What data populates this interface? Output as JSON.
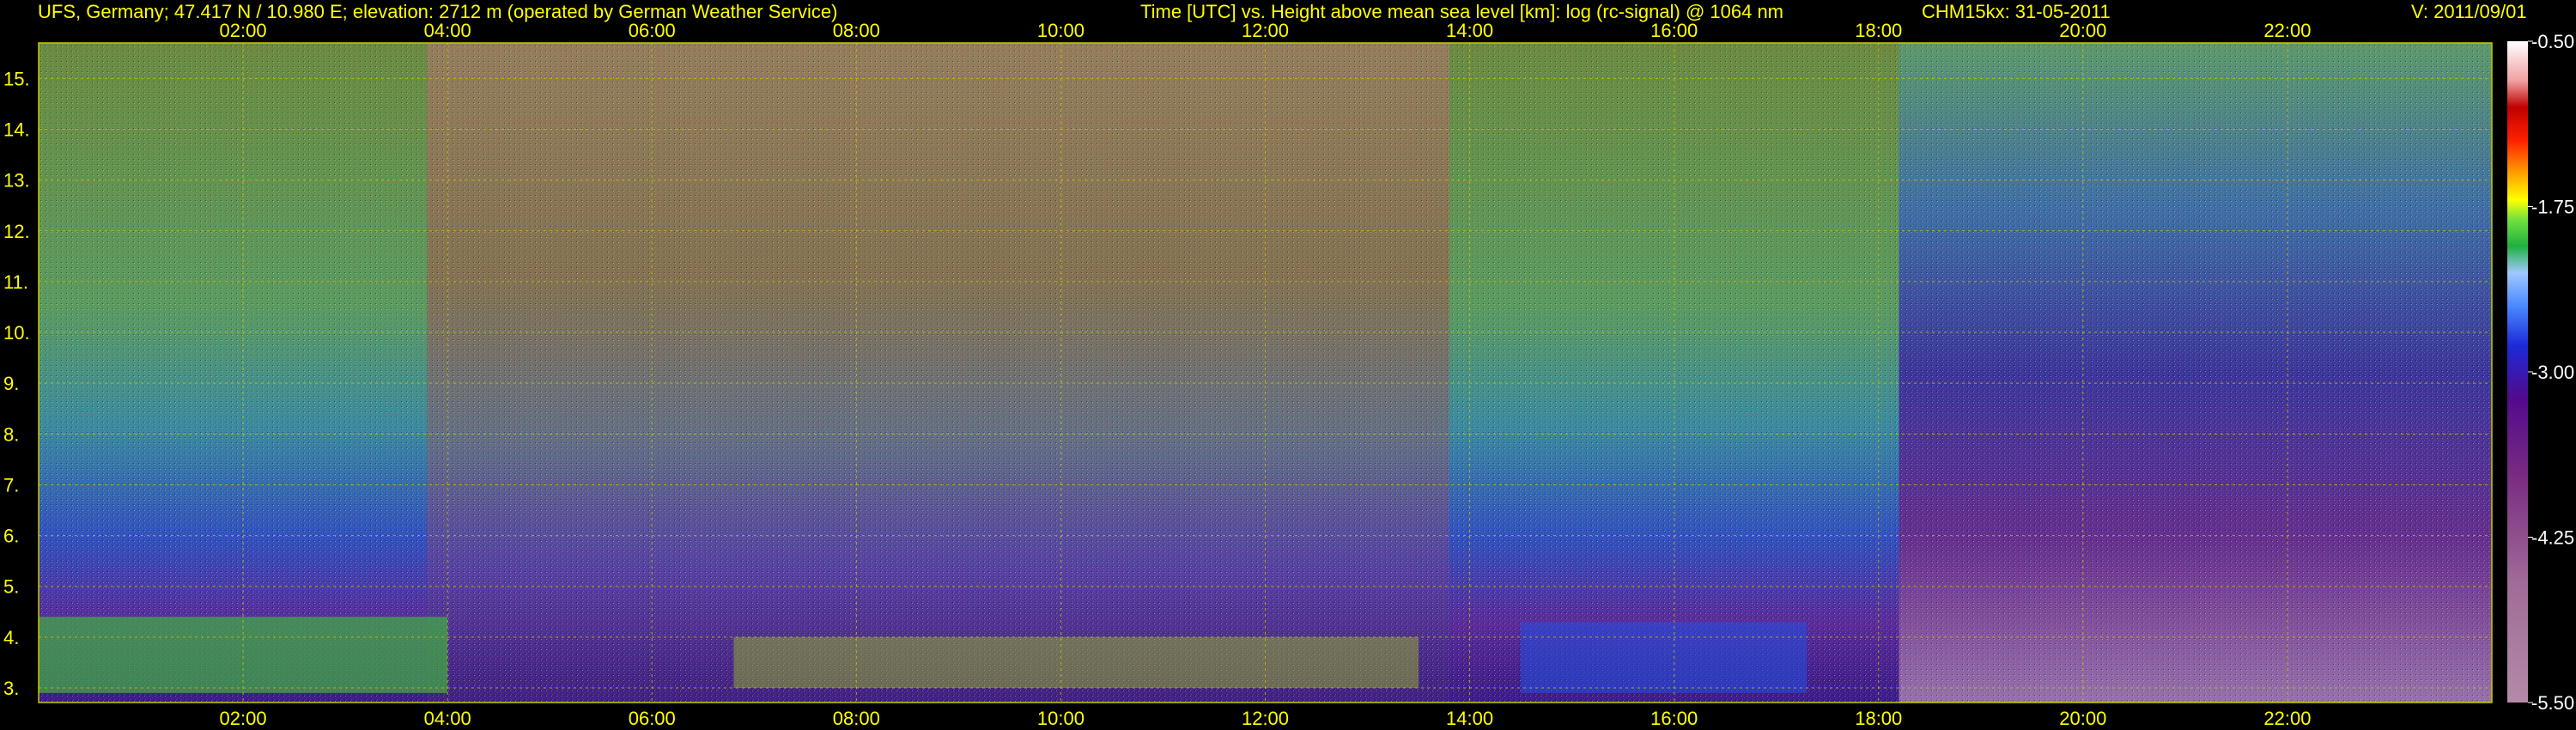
{
  "header": {
    "station": "UFS, Germany; 47.417 N / 10.980 E; elevation: 2712 m  (operated by German Weather Service)",
    "title": "Time [UTC] vs. Height above mean sea level [km]: log (rc-signal) @ 1064 nm",
    "instrument": "CHM15kx: 31-05-2011",
    "version": "V: 2011/09/01"
  },
  "colors": {
    "axis_text": "#ffff00",
    "grid": "#c8c800",
    "colorbar_text": "#ffffff"
  },
  "chart_data": {
    "type": "heatmap",
    "x_unit": "hours UTC",
    "xlim": [
      0,
      24
    ],
    "x_ticks": [
      {
        "value": 2,
        "label": "02:00"
      },
      {
        "value": 4,
        "label": "04:00"
      },
      {
        "value": 6,
        "label": "06:00"
      },
      {
        "value": 8,
        "label": "08:00"
      },
      {
        "value": 10,
        "label": "10:00"
      },
      {
        "value": 12,
        "label": "12:00"
      },
      {
        "value": 14,
        "label": "14:00"
      },
      {
        "value": 16,
        "label": "16:00"
      },
      {
        "value": 18,
        "label": "18:00"
      },
      {
        "value": 20,
        "label": "20:00"
      },
      {
        "value": 22,
        "label": "22:00"
      }
    ],
    "ylim": [
      2.712,
      15.7
    ],
    "y_ticks": [
      {
        "value": 3,
        "label": "3."
      },
      {
        "value": 4,
        "label": "4."
      },
      {
        "value": 5,
        "label": "5."
      },
      {
        "value": 6,
        "label": "6."
      },
      {
        "value": 7,
        "label": "7."
      },
      {
        "value": 8,
        "label": "8."
      },
      {
        "value": 9,
        "label": "9."
      },
      {
        "value": 10,
        "label": "10."
      },
      {
        "value": 11,
        "label": "11."
      },
      {
        "value": 12,
        "label": "12."
      },
      {
        "value": 13,
        "label": "13."
      },
      {
        "value": 14,
        "label": "14."
      },
      {
        "value": 15,
        "label": "15."
      }
    ],
    "grid": true,
    "colorbar": {
      "range": [
        -5.5,
        -0.5
      ],
      "ticks": [
        {
          "value": -0.5,
          "label": "-0.50"
        },
        {
          "value": -1.75,
          "label": "-1.75"
        },
        {
          "value": -3.0,
          "label": "-3.00"
        },
        {
          "value": -4.25,
          "label": "-4.25"
        },
        {
          "value": -5.5,
          "label": "-5.50"
        }
      ],
      "stops": [
        {
          "value": -5.5,
          "color": "#b48aa8"
        },
        {
          "value": -4.6,
          "color": "#a06c98"
        },
        {
          "value": -3.8,
          "color": "#7a2c82"
        },
        {
          "value": -3.2,
          "color": "#520a8c"
        },
        {
          "value": -2.8,
          "color": "#1c2ad8"
        },
        {
          "value": -2.5,
          "color": "#4a8aff"
        },
        {
          "value": -2.25,
          "color": "#a0c8ff"
        },
        {
          "value": -2.05,
          "color": "#20b040"
        },
        {
          "value": -1.85,
          "color": "#70e040"
        },
        {
          "value": -1.7,
          "color": "#ffff00"
        },
        {
          "value": -1.5,
          "color": "#ffa000"
        },
        {
          "value": -1.25,
          "color": "#ff2000"
        },
        {
          "value": -1.0,
          "color": "#c00000"
        },
        {
          "value": -0.8,
          "color": "#f0a0a0"
        },
        {
          "value": -0.5,
          "color": "#ffffff"
        }
      ]
    }
  }
}
